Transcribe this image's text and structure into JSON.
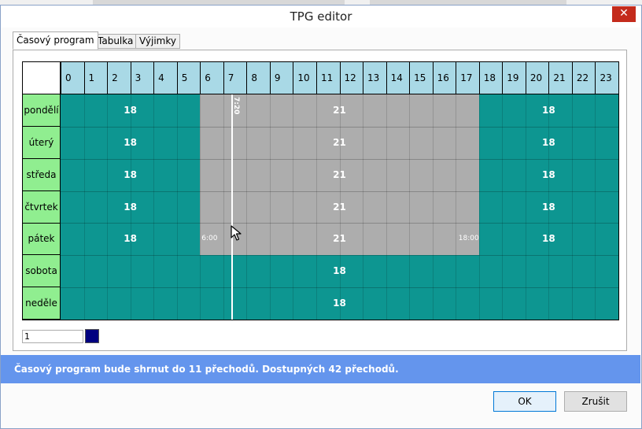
{
  "window": {
    "title": "TPG editor",
    "close_glyph": "✕"
  },
  "tabs": [
    {
      "label": "Časový program",
      "active": true
    },
    {
      "label": "Tabulka",
      "active": false
    },
    {
      "label": "Výjimky",
      "active": false
    }
  ],
  "grid": {
    "hours": [
      "0",
      "1",
      "2",
      "3",
      "4",
      "5",
      "6",
      "7",
      "8",
      "9",
      "10",
      "11",
      "12",
      "13",
      "14",
      "15",
      "16",
      "17",
      "18",
      "19",
      "20",
      "21",
      "22",
      "23"
    ],
    "days": [
      {
        "name": "pondělí",
        "labels": [
          "18",
          "21",
          "18"
        ]
      },
      {
        "name": "úterý",
        "labels": [
          "18",
          "21",
          "18"
        ]
      },
      {
        "name": "středa",
        "labels": [
          "18",
          "21",
          "18"
        ]
      },
      {
        "name": "čtvrtek",
        "labels": [
          "18",
          "21",
          "18"
        ]
      },
      {
        "name": "pátek",
        "labels": [
          "18",
          "21",
          "18"
        ]
      },
      {
        "name": "sobota",
        "labels": [
          "18"
        ]
      },
      {
        "name": "neděle",
        "labels": [
          "18"
        ]
      }
    ],
    "colors": {
      "base": "#0d9691",
      "comfort": "#adadad",
      "hour_header": "#a9d9e6",
      "day_header": "#90ee90"
    },
    "comfort_start_label": "6:00",
    "comfort_end_label": "18:00",
    "cursor_time_label": "7:20",
    "comfort_start_hour": 6,
    "comfort_end_hour": 18,
    "cursor_hour": 7.33
  },
  "input": {
    "value": "1"
  },
  "swatch": {
    "color": "#000080"
  },
  "status": {
    "message": "Časový program bude shrnut do 11 přechodů. Dostupných 42 přechodů."
  },
  "buttons": {
    "ok": "OK",
    "cancel": "Zrušit"
  }
}
